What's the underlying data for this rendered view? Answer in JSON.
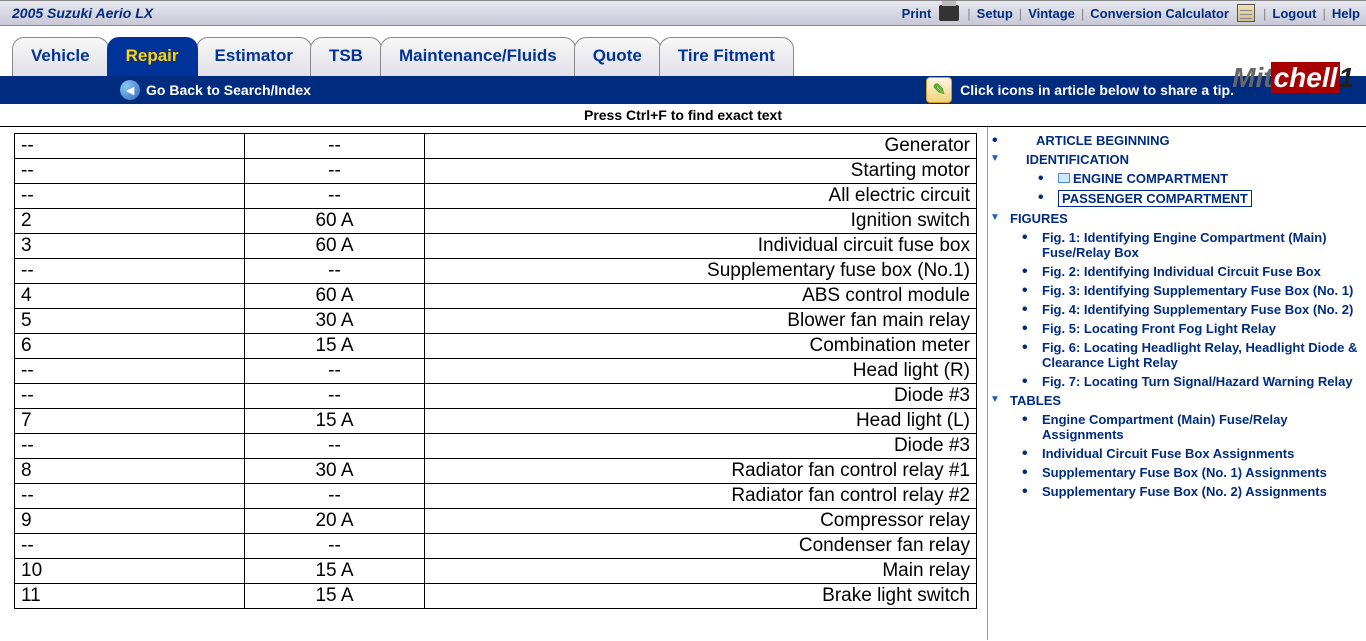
{
  "header": {
    "vehicle": "2005 Suzuki Aerio LX",
    "links": {
      "print": "Print",
      "setup": "Setup",
      "vintage": "Vintage",
      "calc": "Conversion Calculator",
      "logout": "Logout",
      "help": "Help"
    }
  },
  "tabs": [
    "Vehicle",
    "Repair",
    "Estimator",
    "TSB",
    "Maintenance/Fluids",
    "Quote",
    "Tire Fitment"
  ],
  "tabs_active": 1,
  "logo_parts": {
    "a": "Mit",
    "b": "chell",
    "c": "1"
  },
  "bluebar": {
    "back": "Go Back to Search/Index",
    "tip": "Click icons in article below to share a tip."
  },
  "ctrl_f": "Press Ctrl+F to find exact text",
  "fuse_rows": [
    {
      "no": "--",
      "amp": "--",
      "desc": "Generator"
    },
    {
      "no": "--",
      "amp": "--",
      "desc": "Starting motor"
    },
    {
      "no": "--",
      "amp": "--",
      "desc": "All electric circuit"
    },
    {
      "no": "2",
      "amp": "60 A",
      "desc": "Ignition switch"
    },
    {
      "no": "3",
      "amp": "60 A",
      "desc": "Individual circuit fuse box"
    },
    {
      "no": "--",
      "amp": "--",
      "desc": "Supplementary fuse box (No.1)"
    },
    {
      "no": "4",
      "amp": "60 A",
      "desc": "ABS control module"
    },
    {
      "no": "5",
      "amp": "30 A",
      "desc": "Blower fan main relay"
    },
    {
      "no": "6",
      "amp": "15 A",
      "desc": "Combination meter"
    },
    {
      "no": "--",
      "amp": "--",
      "desc": "Head light (R)"
    },
    {
      "no": "--",
      "amp": "--",
      "desc": "Diode #3"
    },
    {
      "no": "7",
      "amp": "15 A",
      "desc": "Head light (L)"
    },
    {
      "no": "--",
      "amp": "--",
      "desc": "Diode #3"
    },
    {
      "no": "8",
      "amp": "30 A",
      "desc": "Radiator fan control relay #1"
    },
    {
      "no": "--",
      "amp": "--",
      "desc": "Radiator fan control relay #2"
    },
    {
      "no": "9",
      "amp": "20 A",
      "desc": "Compressor relay"
    },
    {
      "no": "--",
      "amp": "--",
      "desc": "Condenser fan relay"
    },
    {
      "no": "10",
      "amp": "15 A",
      "desc": "Main relay"
    },
    {
      "no": "11",
      "amp": "15 A",
      "desc": "Brake light switch"
    }
  ],
  "nav": {
    "article_beginning": "ARTICLE BEGINNING",
    "identification": "IDENTIFICATION",
    "engine_compartment": "ENGINE COMPARTMENT",
    "passenger_compartment": "PASSENGER COMPARTMENT",
    "figures": "FIGURES",
    "fig_items": [
      "Fig. 1: Identifying Engine Compartment (Main) Fuse/Relay Box",
      "Fig. 2: Identifying Individual Circuit Fuse Box",
      "Fig. 3: Identifying Supplementary Fuse Box (No. 1)",
      "Fig. 4: Identifying Supplementary Fuse Box (No. 2)",
      "Fig. 5: Locating Front Fog Light Relay",
      "Fig. 6: Locating Headlight Relay, Headlight Diode & Clearance Light Relay",
      "Fig. 7: Locating Turn Signal/Hazard Warning Relay"
    ],
    "tables": "TABLES",
    "table_items": [
      "Engine Compartment (Main) Fuse/Relay Assignments",
      "Individual Circuit Fuse Box Assignments",
      "Supplementary Fuse Box (No. 1) Assignments",
      "Supplementary Fuse Box (No. 2) Assignments"
    ]
  }
}
